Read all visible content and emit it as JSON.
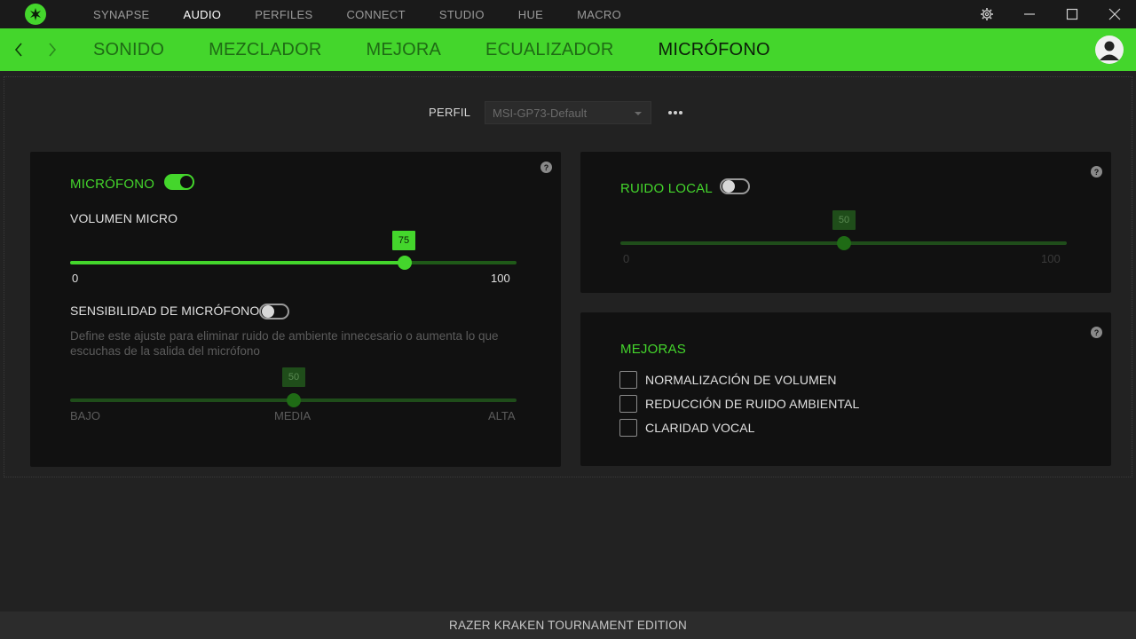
{
  "app": {
    "name": "Razer Synapse",
    "accent": "#44d62c"
  },
  "topnav": {
    "items": [
      {
        "label": "SYNAPSE"
      },
      {
        "label": "AUDIO"
      },
      {
        "label": "PERFILES"
      },
      {
        "label": "CONNECT"
      },
      {
        "label": "STUDIO"
      },
      {
        "label": "HUE"
      },
      {
        "label": "MACRO"
      }
    ],
    "active_index": 1
  },
  "window_controls": {
    "icons": [
      "gear-icon",
      "minimize-icon",
      "maximize-icon",
      "close-icon"
    ]
  },
  "subnav": {
    "tabs": [
      {
        "label": "SONIDO"
      },
      {
        "label": "MEZCLADOR"
      },
      {
        "label": "MEJORA"
      },
      {
        "label": "ECUALIZADOR"
      },
      {
        "label": "MICRÓFONO"
      }
    ],
    "active_index": 4
  },
  "profile": {
    "label": "PERFIL",
    "value": "MSI-GP73-Default"
  },
  "mic_panel": {
    "title": "MICRÓFONO",
    "enabled": true,
    "volume": {
      "label": "VOLUMEN MICRO",
      "value": 75,
      "min": 0,
      "max": 100,
      "min_label": "0",
      "max_label": "100",
      "value_label": "75"
    },
    "sensitivity": {
      "label": "SENSIBILIDAD DE MICRÓFONO",
      "enabled": false,
      "description": "Define este ajuste para eliminar ruido de ambiente innecesario o aumenta lo que escuchas de la salida del micrófono",
      "value": 50,
      "value_label": "50",
      "scale": {
        "low": "BAJO",
        "mid": "MEDIA",
        "high": "ALTA"
      }
    }
  },
  "sidetone_panel": {
    "title": "RUIDO LOCAL",
    "enabled": false,
    "value": 50,
    "value_label": "50",
    "min_label": "0",
    "max_label": "100"
  },
  "enhancements_panel": {
    "title": "MEJORAS",
    "items": [
      {
        "label": "NORMALIZACIÓN DE VOLUMEN",
        "checked": false
      },
      {
        "label": "REDUCCIÓN DE RUIDO AMBIENTAL",
        "checked": false
      },
      {
        "label": "CLARIDAD VOCAL",
        "checked": false
      }
    ]
  },
  "footer": {
    "device": "RAZER KRAKEN TOURNAMENT EDITION"
  }
}
